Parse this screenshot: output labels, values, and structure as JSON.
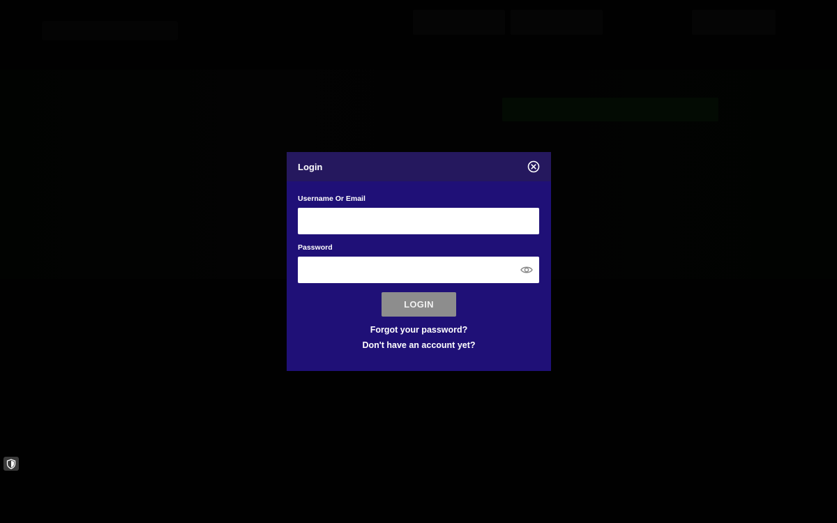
{
  "modal": {
    "title": "Login",
    "username_label": "Username Or Email",
    "username_value": "",
    "password_label": "Password",
    "password_value": "",
    "login_button": "LOGIN",
    "forgot_link": "Forgot your password?",
    "register_link": "Don't have an account yet?"
  },
  "icons": {
    "close": "close-circle-icon",
    "password_toggle": "eye-icon",
    "security": "shield-icon"
  },
  "colors": {
    "modal_background": "#1f1077",
    "modal_header": "#25185e",
    "login_button": "#8d8d8d",
    "overlay": "#000000"
  }
}
